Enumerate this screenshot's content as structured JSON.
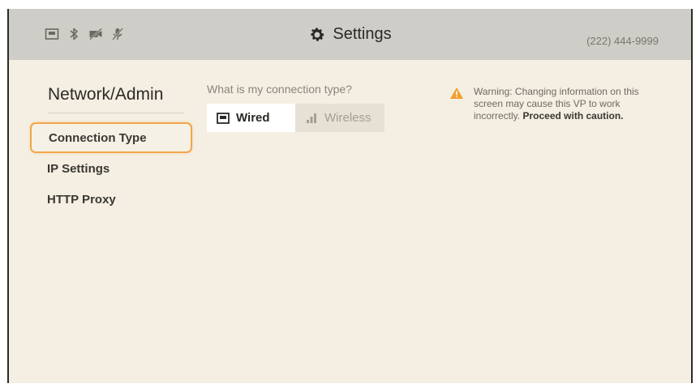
{
  "header": {
    "title": "Settings",
    "phone": "(222) 444-9999",
    "status_icons": [
      "ethernet-icon",
      "bluetooth-icon",
      "camera-off-icon",
      "microphone-off-icon"
    ]
  },
  "sidebar": {
    "title": "Network/Admin",
    "items": [
      {
        "label": "Connection Type",
        "selected": true
      },
      {
        "label": "IP Settings",
        "selected": false
      },
      {
        "label": "HTTP Proxy",
        "selected": false
      }
    ]
  },
  "main": {
    "question": "What is my connection type?",
    "options": [
      {
        "label": "Wired",
        "icon": "ethernet-icon",
        "selected": true
      },
      {
        "label": "Wireless",
        "icon": "signal-bars-icon",
        "selected": false
      }
    ]
  },
  "warning": {
    "icon": "warning-icon",
    "text": "Warning: Changing information on this screen may cause this VP to work incorrectly.",
    "emphasis": "Proceed with caution."
  },
  "colors": {
    "accent_focus": "#f2a54a",
    "background": "#f4efe2",
    "topbar": "#cfcdc7",
    "warning": "#f0a030"
  }
}
